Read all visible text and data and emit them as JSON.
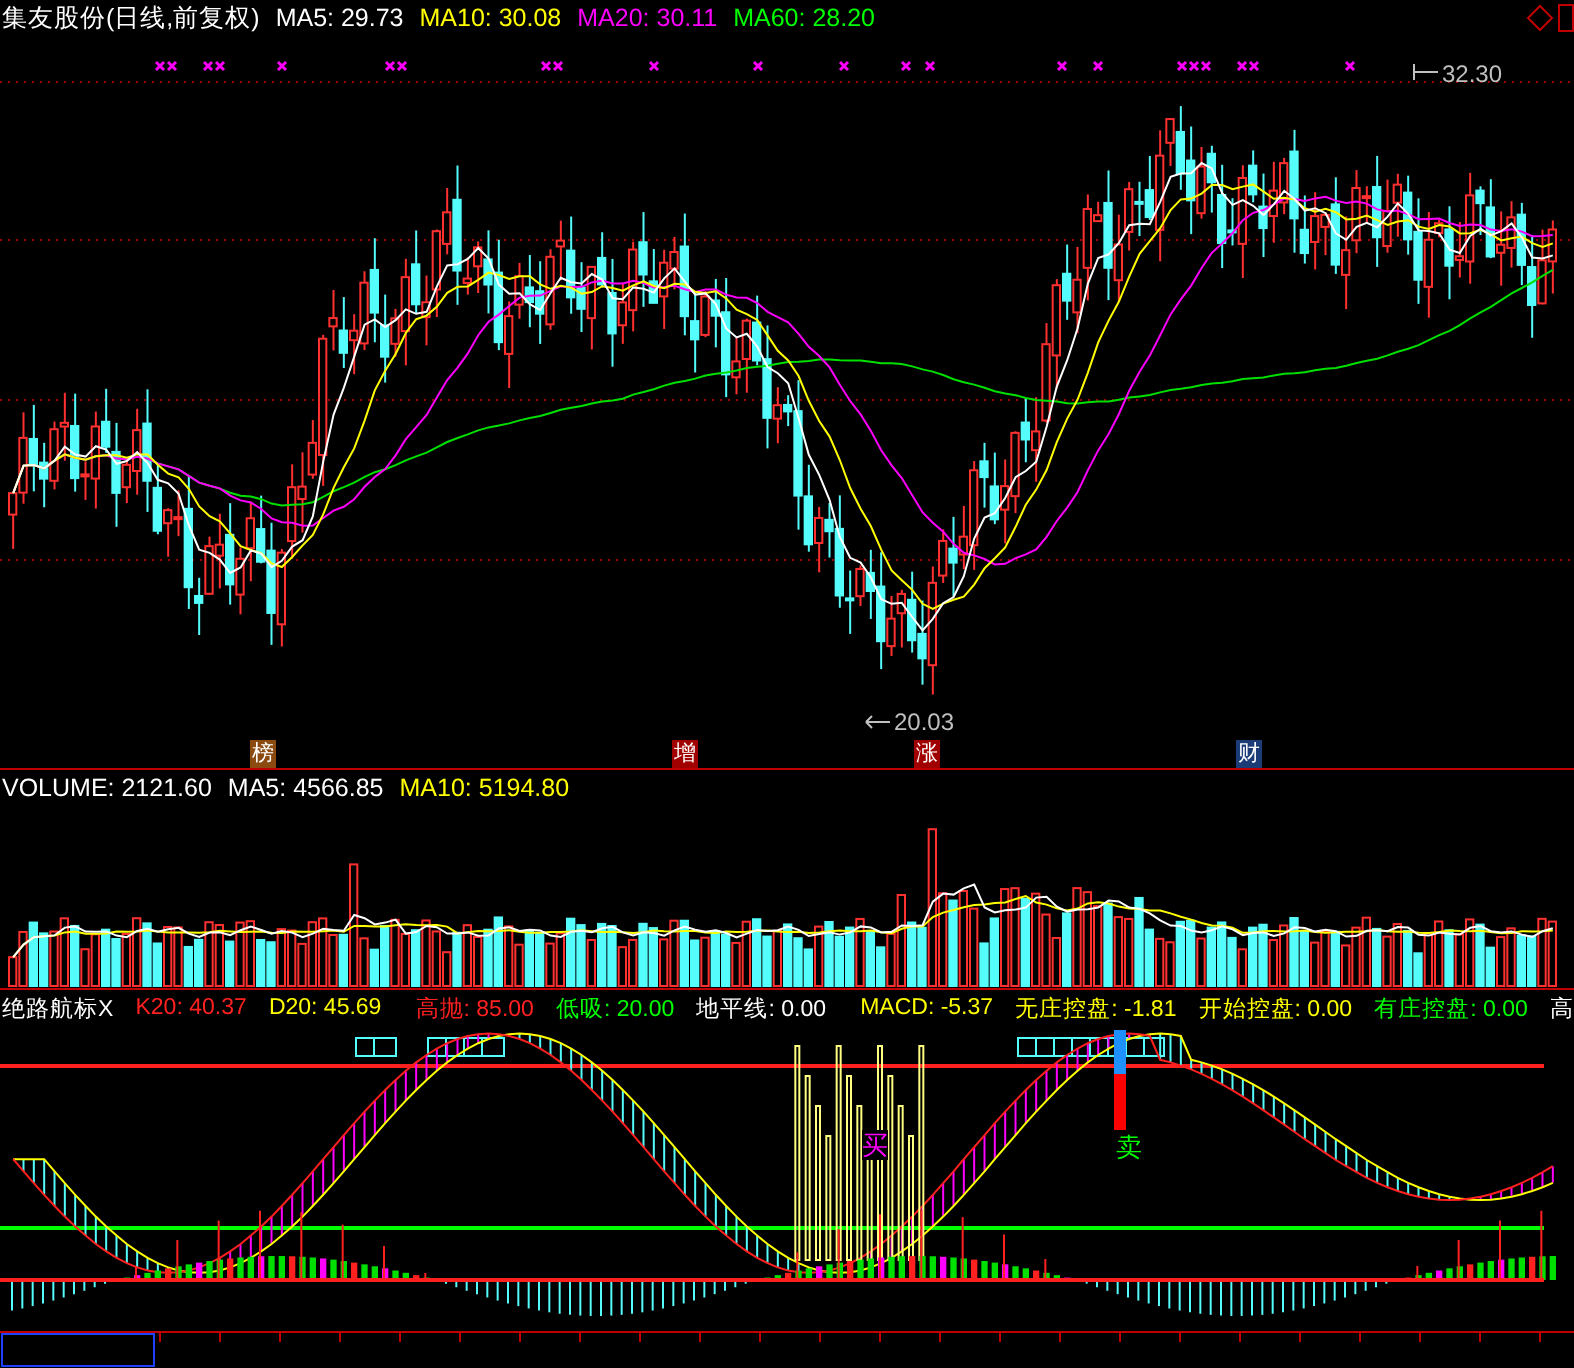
{
  "price_panel": {
    "title": "集友股份(日线,前复权)",
    "indicators": [
      {
        "label": "MA5: 29.73",
        "color": "#ffffff"
      },
      {
        "label": "MA10: 30.08",
        "color": "#ffff00"
      },
      {
        "label": "MA20: 30.11",
        "color": "#ff00ff"
      },
      {
        "label": "MA60: 28.20",
        "color": "#00ff00"
      }
    ],
    "high_marker": "32.30",
    "low_marker": "20.03",
    "event_tags": [
      {
        "label": "榜",
        "color": "#8b4a10"
      },
      {
        "label": "增",
        "color": "#a00000"
      },
      {
        "label": "涨",
        "color": "#a00000"
      },
      {
        "label": "财",
        "color": "#1c3c78"
      }
    ]
  },
  "volume_panel": {
    "indicators": [
      {
        "label": "VOLUME: 2121.60",
        "color": "#ffffff"
      },
      {
        "label": "MA5: 4566.85",
        "color": "#ffffff"
      },
      {
        "label": "MA10: 5194.80",
        "color": "#ffff00"
      }
    ]
  },
  "oscillator_panel": {
    "indicators": [
      {
        "label": "绝路航标X",
        "color": "#ffffff"
      },
      {
        "label": "K20: 40.37",
        "color": "#ff2020"
      },
      {
        "label": "D20: 45.69",
        "color": "#ffff00"
      },
      {
        "label": "高抛: 85.00",
        "color": "#ff2020"
      },
      {
        "label": "低吸: 20.00",
        "color": "#00ff00"
      },
      {
        "label": "地平线: 0.00",
        "color": "#ffffff"
      },
      {
        "label": "MACD: -5.37",
        "color": "#ffff00"
      },
      {
        "label": "无庄控盘: -1.81",
        "color": "#ffff00"
      },
      {
        "label": "开始控盘: 0.00",
        "color": "#ffff00"
      },
      {
        "label": "有庄控盘: 0.00",
        "color": "#00ff00"
      },
      {
        "label": "高",
        "color": "#ffffff"
      }
    ],
    "signals": [
      {
        "label": "买",
        "kind": "buy"
      },
      {
        "label": "卖",
        "kind": "sell"
      }
    ]
  }
}
